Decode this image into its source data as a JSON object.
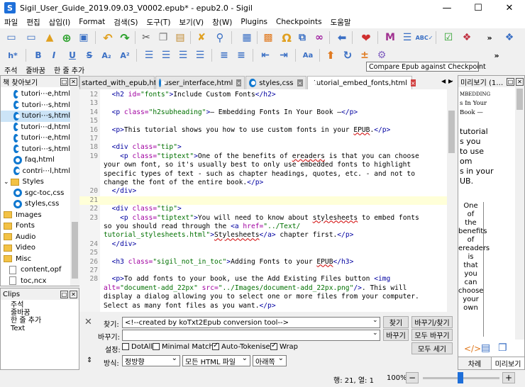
{
  "window": {
    "title": "Sigil_User_Guide_2019.09.03_V0002.epub* - epub2.0 - Sigil",
    "app_icon": "S"
  },
  "menu": [
    "파일",
    "편집",
    "삽입(I)",
    "Format",
    "검색(S)",
    "도구(T)",
    "보기(V)",
    "창(W)",
    "Plugins",
    "Checkpoints",
    "도움말"
  ],
  "toolbar": {
    "more_1": "»",
    "more_2": "»",
    "heading_icon": "h*"
  },
  "charbar": [
    "주석",
    "줄바꿈",
    "한 줄 추가"
  ],
  "tooltip": "Compare Epub against Checkpoint",
  "book_browser": {
    "title": "책 찾아보기",
    "items": [
      {
        "label": "tutori⋯e,html",
        "type": "html"
      },
      {
        "label": "tutori⋯s,html",
        "type": "html"
      },
      {
        "label": "tutori⋯s,html",
        "type": "html",
        "selected": true
      },
      {
        "label": "tutori⋯d,html",
        "type": "html"
      },
      {
        "label": "tutori⋯e,html",
        "type": "html"
      },
      {
        "label": "tutori⋯s,html",
        "type": "html"
      },
      {
        "label": "faq,html",
        "type": "html"
      },
      {
        "label": "contri⋯l,html",
        "type": "html"
      },
      {
        "label": "Styles",
        "type": "folder-open"
      },
      {
        "label": "sgc-toc,css",
        "type": "css"
      },
      {
        "label": "styles,css",
        "type": "css"
      },
      {
        "label": "Images",
        "type": "folder"
      },
      {
        "label": "Fonts",
        "type": "folder"
      },
      {
        "label": "Audio",
        "type": "folder"
      },
      {
        "label": "Video",
        "type": "folder"
      },
      {
        "label": "Misc",
        "type": "folder"
      },
      {
        "label": "content,opf",
        "type": "file"
      },
      {
        "label": "toc,ncx",
        "type": "file"
      }
    ]
  },
  "clips": {
    "title": "Clips",
    "items": [
      "주석",
      "줄바꿈",
      "한 줄 추가",
      "Text"
    ]
  },
  "tabs": [
    {
      "label": "started_with_epub,html",
      "active": false,
      "icon": false
    },
    {
      "label": "user_interface,html",
      "active": false,
      "icon": true
    },
    {
      "label": "styles,css",
      "active": false,
      "icon": true
    },
    {
      "label": "tutorial_embed_fonts,html",
      "active": true,
      "icon": true
    }
  ],
  "tab_close": "×",
  "tab_nav": [
    "◀",
    "▶",
    "⌄"
  ],
  "editor": {
    "lines": [
      {
        "n": "12",
        "html": "  <span class='tg'>&lt;h2</span> <span class='at'>id=</span><span class='st'>\"fonts\"</span><span class='tg'>&gt;</span>Include Custom Fonts<span class='tg'>&lt;/h2&gt;</span>"
      },
      {
        "n": "13",
        "html": ""
      },
      {
        "n": "14",
        "html": "  <span class='tg'>&lt;p</span> <span class='at'>class=</span><span class='st'>\"h2subheading\"</span><span class='tg'>&gt;</span>— Embedding Fonts In Your Book —<span class='tg'>&lt;/p&gt;</span>"
      },
      {
        "n": "15",
        "html": ""
      },
      {
        "n": "16",
        "html": "  <span class='tg'>&lt;p&gt;</span>This tutorial shows you how to use custom fonts in your <span class='sq'>EPUB</span>.<span class='tg'>&lt;/p&gt;</span>"
      },
      {
        "n": "17",
        "html": ""
      },
      {
        "n": "18",
        "html": "  <span class='tg'>&lt;div</span> <span class='at'>class=</span><span class='st'>\"tip\"</span><span class='tg'>&gt;</span>"
      },
      {
        "n": "19",
        "html": "    <span class='tg'>&lt;p</span> <span class='at'>class=</span><span class='st'>\"tiptext\"</span><span class='tg'>&gt;</span>One of the benefits of <span class='sq'>ereaders</span> is that you can choose"
      },
      {
        "n": "",
        "html": "your own font, so it's usually best to only use embedded fonts to highlight"
      },
      {
        "n": "",
        "html": "specific types of text - such as chapter headings, quotes, etc. - and not to"
      },
      {
        "n": "",
        "html": "change the font of the entire book.<span class='tg'>&lt;/p&gt;</span>"
      },
      {
        "n": "20",
        "html": "  <span class='tg'>&lt;/div&gt;</span>"
      },
      {
        "n": "21",
        "html": "",
        "hl": true
      },
      {
        "n": "22",
        "html": "  <span class='tg'>&lt;div</span> <span class='at'>class=</span><span class='st'>\"tip\"</span><span class='tg'>&gt;</span>"
      },
      {
        "n": "23",
        "html": "    <span class='tg'>&lt;p</span> <span class='at'>class=</span><span class='st'>\"tiptext\"</span><span class='tg'>&gt;</span>You will need to know about <span class='sq'>stylesheets</span> to embed fonts"
      },
      {
        "n": "",
        "html": "so you should read through the <span class='tg'>&lt;a</span> <span class='at'>href=</span><span class='st'>\"../Text/</span>"
      },
      {
        "n": "",
        "html": "<span class='st'>tutorial_stylesheets.html\"</span><span class='tg'>&gt;</span><span class='sq'>Stylesheets</span><span class='tg'>&lt;/a&gt;</span> chapter first.<span class='tg'>&lt;/p&gt;</span>"
      },
      {
        "n": "24",
        "html": "  <span class='tg'>&lt;/div&gt;</span>"
      },
      {
        "n": "25",
        "html": ""
      },
      {
        "n": "26",
        "html": "  <span class='tg'>&lt;h3</span> <span class='at'>class=</span><span class='st'>\"sigil_not_in_toc\"</span><span class='tg'>&gt;</span>Adding Fonts to your <span class='sq'>EPUB</span><span class='tg'>&lt;/h3&gt;</span>"
      },
      {
        "n": "27",
        "html": ""
      },
      {
        "n": "28",
        "html": "  <span class='tg'>&lt;p&gt;</span>To add fonts to your book, use the Add Existing Files button <span class='tg'>&lt;img</span>"
      },
      {
        "n": "",
        "html": "<span class='at'>alt=</span><span class='st'>\"document-add_22px\"</span> <span class='at'>src=</span><span class='st'>\"../Images/document-add_22px.png\"</span><span class='tg'>/&gt;</span>. This will"
      },
      {
        "n": "",
        "html": "display a dialog allowing you to select one or more files from your computer."
      },
      {
        "n": "",
        "html": "Select as many font files as you want.<span class='tg'>&lt;/p&gt;</span>"
      },
      {
        "n": "",
        "html": ""
      },
      {
        "n": "29",
        "html": ""
      }
    ]
  },
  "find": {
    "find_label": "찾기:",
    "find_value": "<!--created by koTxt2Epub conversion tool-->",
    "replace_label": "바꾸기:",
    "replace_value": "",
    "btn_find": "찾기",
    "btn_replace_find": "바꾸기/찾기",
    "btn_replace": "바꾸기",
    "btn_replace_all": "모두 바꾸기",
    "btn_count_all": "모두 세기",
    "options_label": "설정:",
    "opt_dotall": "DotAll",
    "opt_minimal": "Minimal Match",
    "opt_autotok": "Auto-Tokenise",
    "opt_wrap": "Wrap",
    "mode_label": "방식:",
    "mode_value": "정방향",
    "scope_value": "모든 HTML 파일",
    "direction_value": "아래쪽",
    "close": "✕",
    "collapse": "⇕"
  },
  "preview": {
    "title": "미리보기 (1…",
    "text_top": [
      "MBEDDING",
      "s In Your",
      "Book —"
    ],
    "text_mid": [
      "tutorial",
      "s you",
      "to use",
      "om",
      "s in your",
      "UB."
    ],
    "tip_words": [
      "One",
      "of",
      "the",
      "benefits",
      "of",
      "ereaders",
      "is",
      "that",
      "you",
      "can",
      "choose",
      "your",
      "own"
    ]
  },
  "bottom_tabs": [
    "차례",
    "미리보기"
  ],
  "status": {
    "position": "행: 21, 열: 1",
    "zoom": "100%",
    "minus": "−",
    "plus": "+"
  },
  "colors": {
    "accent": "#0f78d0",
    "highlight_line": "#ffffd8",
    "tag": "#0000a0",
    "attr": "#a000a0",
    "string": "#007000"
  }
}
